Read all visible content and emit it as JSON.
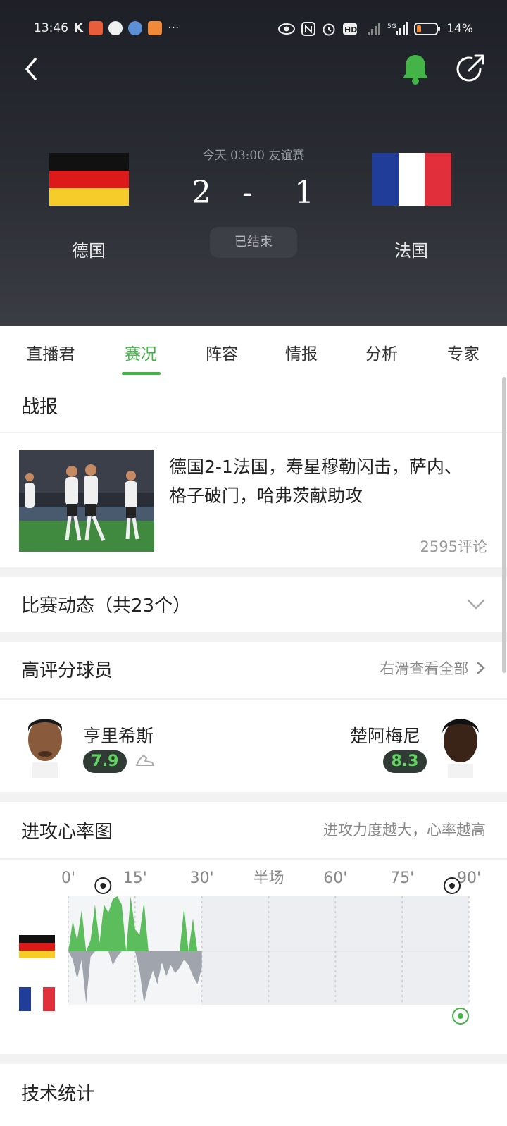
{
  "status_bar": {
    "time": "13:46",
    "left_icons": [
      "k-icon",
      "ting-icon",
      "chat-bubble-icon",
      "app-icon",
      "taobao-icon"
    ],
    "more": "···",
    "right_icons": [
      "eye-icon",
      "nfc-icon",
      "alarm-icon",
      "hd-icon",
      "signal-icon",
      "5g-signal-icon",
      "battery-icon"
    ],
    "battery": "14%"
  },
  "header": {
    "match_info": "今天 03:00 友谊赛",
    "home_team": "德国",
    "away_team": "法国",
    "home_score": "2",
    "separator": "-",
    "away_score": "1",
    "status": "已结束",
    "accent_color": "#44b449"
  },
  "tabs": [
    {
      "label": "直播君",
      "active": false
    },
    {
      "label": "赛况",
      "active": true
    },
    {
      "label": "阵容",
      "active": false
    },
    {
      "label": "情报",
      "active": false
    },
    {
      "label": "分析",
      "active": false
    },
    {
      "label": "专家",
      "active": false
    }
  ],
  "report": {
    "title": "战报",
    "news_title": "德国2-1法国，寿星穆勒闪击，萨内、格子破门，哈弗茨献助攻",
    "comments": "2595评论"
  },
  "events": {
    "title": "比赛动态（共23个）"
  },
  "top_players": {
    "title": "高评分球员",
    "hint": "右滑查看全部",
    "home_player": {
      "name": "亨里希斯",
      "rating": "7.9"
    },
    "away_player": {
      "name": "楚阿梅尼",
      "rating": "8.3"
    }
  },
  "attack_chart": {
    "title": "进攻心率图",
    "hint": "进攻力度越大，心率越高",
    "ticks": [
      "0'",
      "15'",
      "30'",
      "半场",
      "60'",
      "75'",
      "90'"
    ]
  },
  "chart_data": {
    "type": "area",
    "x_range": [
      0,
      90
    ],
    "played_until": 30,
    "x_ticks": [
      "0'",
      "15'",
      "30'",
      "半场",
      "60'",
      "75'",
      "90'"
    ],
    "series": [
      {
        "name": "德国",
        "color": "#5cbd5c",
        "points": [
          [
            0,
            0
          ],
          [
            1,
            0.55
          ],
          [
            2,
            0.2
          ],
          [
            3,
            0.75
          ],
          [
            4,
            0
          ],
          [
            5,
            0.2
          ],
          [
            6,
            0.85
          ],
          [
            7,
            0.15
          ],
          [
            8,
            0.85
          ],
          [
            9,
            0.7
          ],
          [
            10,
            0.95
          ],
          [
            11,
            1.0
          ],
          [
            12,
            0.85
          ],
          [
            13,
            0
          ],
          [
            14,
            1.0
          ],
          [
            15,
            0.4
          ],
          [
            16,
            0.3
          ],
          [
            17,
            0.9
          ],
          [
            18,
            0
          ],
          [
            19,
            0
          ],
          [
            25,
            0
          ],
          [
            26,
            0.8
          ],
          [
            27,
            0
          ],
          [
            28,
            0.6
          ],
          [
            29,
            0
          ],
          [
            30,
            0
          ]
        ]
      },
      {
        "name": "法国",
        "color": "#9fa4ad",
        "points": [
          [
            0,
            0
          ],
          [
            1,
            -0.15
          ],
          [
            2,
            -0.5
          ],
          [
            3,
            -0.15
          ],
          [
            4,
            -0.95
          ],
          [
            5,
            -0.1
          ],
          [
            6,
            0
          ],
          [
            9,
            0
          ],
          [
            10,
            -0.25
          ],
          [
            11,
            -0.1
          ],
          [
            12,
            0
          ],
          [
            15,
            0
          ],
          [
            16,
            -0.35
          ],
          [
            17,
            -0.95
          ],
          [
            18,
            -0.6
          ],
          [
            19,
            -0.35
          ],
          [
            20,
            -0.6
          ],
          [
            21,
            -0.2
          ],
          [
            22,
            -0.45
          ],
          [
            23,
            -0.25
          ],
          [
            24,
            -0.4
          ],
          [
            25,
            -0.3
          ],
          [
            26,
            -0.15
          ],
          [
            27,
            -0.25
          ],
          [
            28,
            -0.45
          ],
          [
            29,
            -0.6
          ],
          [
            30,
            -0.3
          ]
        ]
      }
    ],
    "goals": [
      {
        "minute": 4,
        "team": "德国"
      },
      {
        "minute": 90,
        "team": "德国"
      },
      {
        "minute": 90,
        "team": "法国"
      }
    ]
  },
  "tech_stats": {
    "title": "技术统计"
  }
}
